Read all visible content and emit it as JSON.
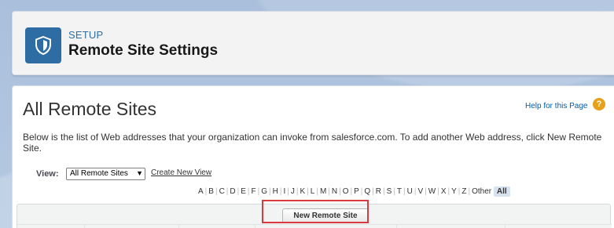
{
  "header": {
    "setup_label": "SETUP",
    "page_title": "Remote Site Settings",
    "icon": "shield-icon"
  },
  "main": {
    "title": "All Remote Sites",
    "help_link": "Help for this Page",
    "help_icon": "question-icon",
    "description": "Below is the list of Web addresses that your organization can invoke from salesforce.com. To add another Web address, click New Remote Site.",
    "view_label": "View:",
    "view_selected": "All Remote Sites",
    "create_view": "Create New View",
    "alphabet": [
      "A",
      "B",
      "C",
      "D",
      "E",
      "F",
      "G",
      "H",
      "I",
      "J",
      "K",
      "L",
      "M",
      "N",
      "O",
      "P",
      "Q",
      "R",
      "S",
      "T",
      "U",
      "V",
      "W",
      "X",
      "Y",
      "Z",
      "Other",
      "All"
    ],
    "new_button": "New Remote Site"
  },
  "colors": {
    "accent": "#2e6da4",
    "highlight": "#d9393f",
    "help": "#e6a019"
  }
}
